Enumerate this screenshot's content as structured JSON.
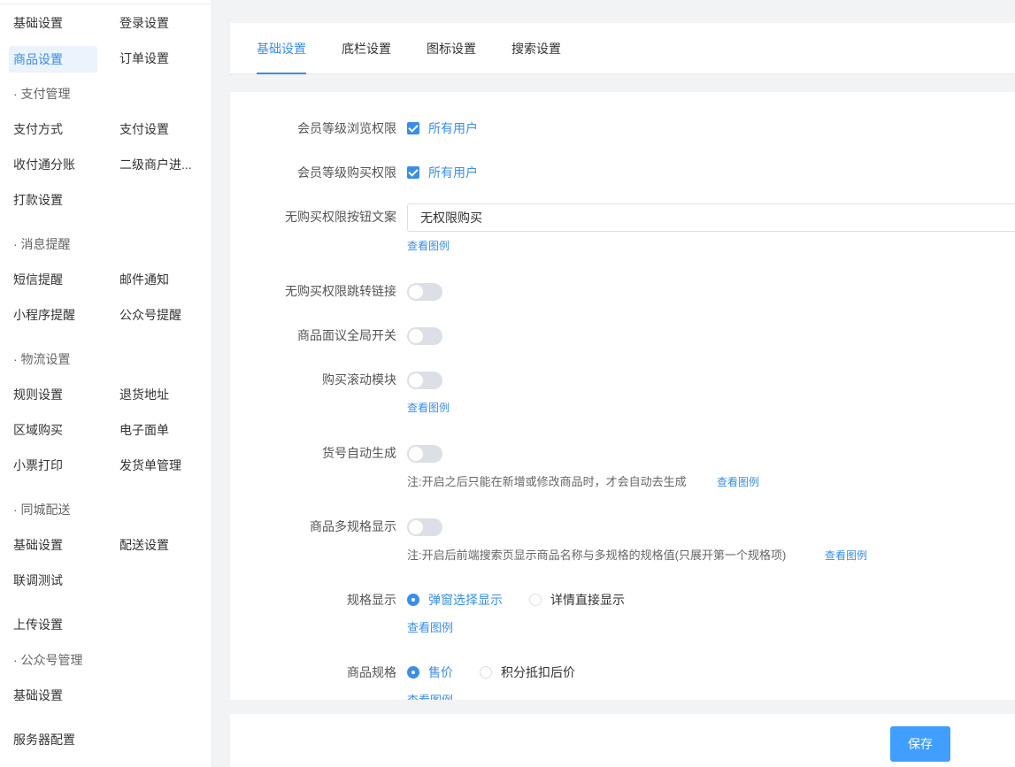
{
  "sidebar": {
    "rows": [
      {
        "c1": "基础设置",
        "c2": "登录设置"
      },
      {
        "c1": "商品设置",
        "c2": "订单设置"
      },
      {
        "group": "· 支付管理"
      },
      {
        "c1": "支付方式",
        "c2": "支付设置"
      },
      {
        "c1": "收付通分账",
        "c2": "二级商户进..."
      },
      {
        "c1": "打款设置"
      },
      {
        "group": "· 消息提醒"
      },
      {
        "c1": "短信提醒",
        "c2": "邮件通知"
      },
      {
        "c1": "小程序提醒",
        "c2": "公众号提醒"
      },
      {
        "group": "· 物流设置"
      },
      {
        "c1": "规则设置",
        "c2": "退货地址"
      },
      {
        "c1": "区域购买",
        "c2": "电子面单"
      },
      {
        "c1": "小票打印",
        "c2": "发货单管理"
      },
      {
        "group": "· 同城配送"
      },
      {
        "c1": "基础设置",
        "c2": "配送设置"
      },
      {
        "c1": "联调测试"
      },
      {
        "c1": "上传设置"
      },
      {
        "group": "· 公众号管理"
      },
      {
        "c1": "基础设置"
      },
      {
        "c1": "服务器配置"
      }
    ]
  },
  "tabs": [
    "基础设置",
    "底栏设置",
    "图标设置",
    "搜索设置"
  ],
  "form": {
    "browse_perm": {
      "label": "会员等级浏览权限",
      "option": "所有用户"
    },
    "buy_perm": {
      "label": "会员等级购买权限",
      "option": "所有用户"
    },
    "no_buy_text": {
      "label": "无购买权限按钮文案",
      "value": "无权限购买",
      "link": "查看图例"
    },
    "no_buy_link": {
      "label": "无购买权限跳转链接"
    },
    "negotiate": {
      "label": "商品面议全局开关"
    },
    "scroll_module": {
      "label": "购买滚动模块",
      "link": "查看图例"
    },
    "auto_sku": {
      "label": "货号自动生成",
      "note": "注:开启之后只能在新增或修改商品时，才会自动去生成",
      "link": "查看图例"
    },
    "multi_spec": {
      "label": "商品多规格显示",
      "note": "注:开启后前端搜索页显示商品名称与多规格的规格值(只展开第一个规格项)",
      "link": "查看图例"
    },
    "spec_display": {
      "label": "规格显示",
      "opt1": "弹窗选择显示",
      "opt2": "详情直接显示",
      "link": "查看图例"
    },
    "goods_spec": {
      "label": "商品规格",
      "opt1": "售价",
      "opt2": "积分抵扣后价",
      "link": "查看图例"
    }
  },
  "save_label": "保存",
  "accent": "#3a8ee6"
}
